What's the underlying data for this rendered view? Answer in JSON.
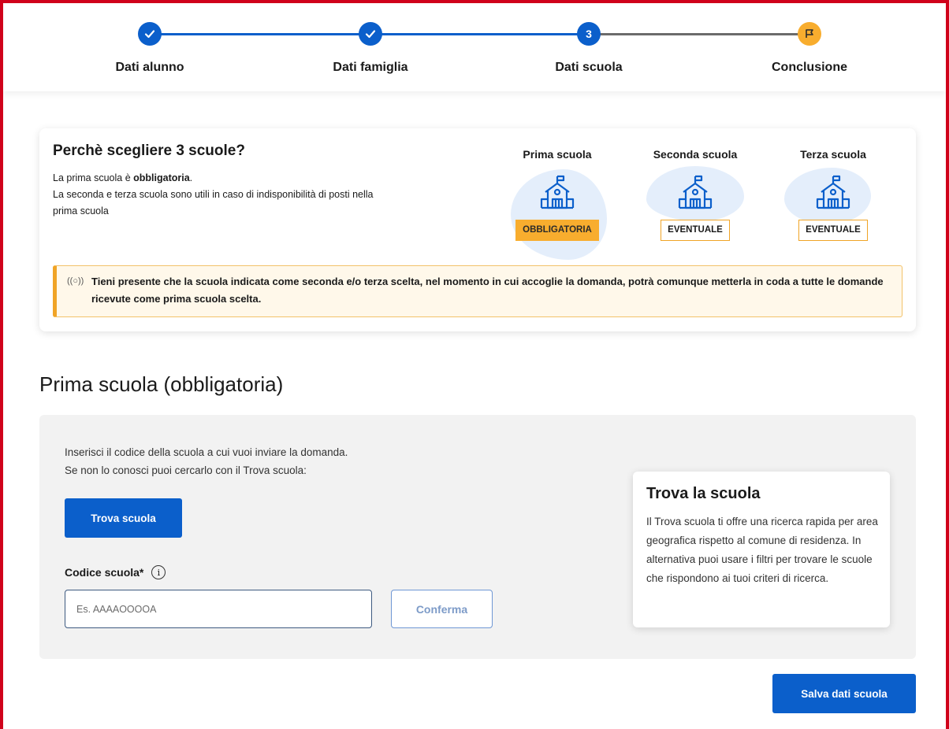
{
  "stepper": {
    "steps": [
      {
        "label": "Dati alunno",
        "state": "done",
        "icon": "check-icon"
      },
      {
        "label": "Dati famiglia",
        "state": "done",
        "icon": "check-icon"
      },
      {
        "label": "Dati scuola",
        "state": "active",
        "number": "3"
      },
      {
        "label": "Conclusione",
        "state": "pending",
        "icon": "flag-icon"
      }
    ]
  },
  "info": {
    "title": "Perchè scegliere 3 scuole?",
    "line1_pre": "La prima scuola è ",
    "line1_bold": "obbligatoria",
    "line1_post": ".",
    "line2": "La seconda e terza scuola sono utili in caso di indisponibilità di posti nella prima scuola",
    "schools": [
      {
        "name": "Prima scuola",
        "badge": "OBBLIGATORIA",
        "kind": "required"
      },
      {
        "name": "Seconda scuola",
        "badge": "EVENTUALE",
        "kind": "optional"
      },
      {
        "name": "Terza scuola",
        "badge": "EVENTUALE",
        "kind": "optional"
      }
    ],
    "notice": "Tieni presente che la scuola indicata come seconda e/o terza scelta, nel momento in cui accoglie la domanda, potrà comunque metterla in coda a tutte le domande ricevute come prima scuola scelta."
  },
  "section": {
    "title": "Prima scuola (obbligatoria)",
    "instructions_1": "Inserisci il codice della scuola a cui vuoi inviare la domanda.",
    "instructions_2": "Se non lo conosci puoi cercarlo con il Trova scuola:",
    "find_button": "Trova scuola",
    "code_label": "Codice scuola*",
    "code_placeholder": "Es. AAAAOOOOA",
    "code_value": "",
    "confirm_button": "Conferma"
  },
  "find_card": {
    "title": "Trova la scuola",
    "text": "Il Trova scuola ti offre una ricerca rapida per area geografica rispetto al comune di residenza. In alternativa puoi usare i filtri per trovare le scuole che rispondono ai tuoi criteri di ricerca."
  },
  "save_button": "Salva dati scuola",
  "colors": {
    "primary": "#0b5fcb",
    "warning": "#f8ad2e",
    "notice_bg": "#fff8ea",
    "frame": "#d0021b"
  }
}
